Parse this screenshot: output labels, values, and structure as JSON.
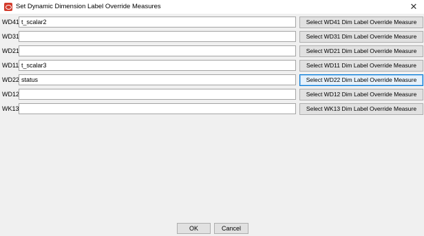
{
  "window": {
    "title": "Set Dynamic Dimension Label Override Measures",
    "icon": "oracle-icon",
    "close_glyph": "✕"
  },
  "rows": [
    {
      "label": "WD41",
      "value": "t_scalar2",
      "button_label": "Select WD41 Dim Label Override Measure"
    },
    {
      "label": "WD31",
      "value": "",
      "button_label": "Select WD31 Dim Label Override Measure"
    },
    {
      "label": "WD21",
      "value": "",
      "button_label": "Select WD21 Dim Label Override Measure"
    },
    {
      "label": "WD11",
      "value": "t_scalar3",
      "button_label": "Select WD11 Dim Label Override Measure"
    },
    {
      "label": "WD22",
      "value": "status",
      "button_label": "Select WD22 Dim Label Override Measure"
    },
    {
      "label": "WD12",
      "value": "",
      "button_label": "Select WD12 Dim Label Override Measure"
    },
    {
      "label": "WK13",
      "value": "",
      "button_label": "Select WK13 Dim Label Override Measure"
    }
  ],
  "footer": {
    "ok_label": "OK",
    "cancel_label": "Cancel"
  },
  "colors": {
    "oracle_icon": "#d33b2c",
    "focus_border": "#0078d7"
  }
}
